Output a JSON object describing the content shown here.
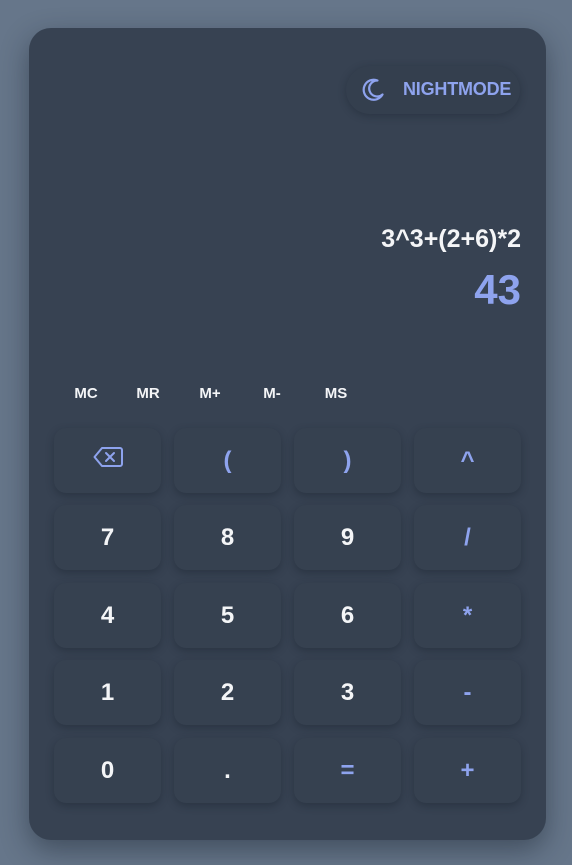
{
  "colors": {
    "page_background": "#66768a",
    "panel": "#374252",
    "key": "#364150",
    "accent": "#8ea3ee",
    "text": "#f4f5f7"
  },
  "header": {
    "nightmode_label": "NIGHTMODE",
    "nightmode_icon": "moon-icon"
  },
  "display": {
    "expression": "3^3+(2+6)*2",
    "result": "43"
  },
  "memory": {
    "mc": "MC",
    "mr": "MR",
    "mplus": "M+",
    "mminus": "M-",
    "ms": "MS"
  },
  "keys": {
    "backspace_icon": "backspace-icon",
    "open_paren": "(",
    "close_paren": ")",
    "power": "^",
    "seven": "7",
    "eight": "8",
    "nine": "9",
    "divide": "/",
    "four": "4",
    "five": "5",
    "six": "6",
    "multiply": "*",
    "one": "1",
    "two": "2",
    "three": "3",
    "minus": "-",
    "zero": "0",
    "dot": ".",
    "equals": "=",
    "plus": "+"
  }
}
